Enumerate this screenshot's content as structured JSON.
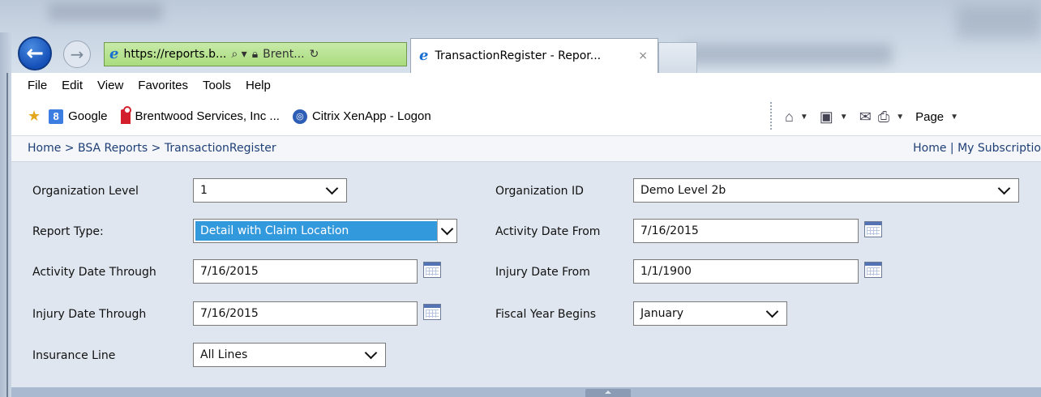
{
  "browser": {
    "address_url": "https://reports.b...",
    "address_site": "Brent...",
    "tab_title": "TransactionRegister - Repor...",
    "tab_close": "×"
  },
  "menu": [
    "File",
    "Edit",
    "View",
    "Favorites",
    "Tools",
    "Help"
  ],
  "favorites": {
    "items": [
      "Google",
      "Brentwood Services, Inc ...",
      "Citrix XenApp - Logon"
    ]
  },
  "command_bar": {
    "page_label": "Page"
  },
  "breadcrumb": {
    "path": "Home > BSA Reports > TransactionRegister",
    "links": "Home | My Subscriptio"
  },
  "params": {
    "org_level": {
      "label": "Organization Level",
      "value": "1"
    },
    "org_id": {
      "label": "Organization ID",
      "value": "Demo Level 2b"
    },
    "report_type": {
      "label": "Report Type:",
      "value": "Detail with Claim Location"
    },
    "activity_from": {
      "label": "Activity Date From",
      "value": "7/16/2015"
    },
    "activity_through": {
      "label": "Activity Date Through",
      "value": "7/16/2015"
    },
    "injury_from": {
      "label": "Injury Date From",
      "value": "1/1/1900"
    },
    "injury_through": {
      "label": "Injury Date Through",
      "value": "7/16/2015"
    },
    "fiscal_year": {
      "label": "Fiscal Year Begins",
      "value": "January"
    },
    "insurance_line": {
      "label": "Insurance Line",
      "value": "All Lines"
    }
  },
  "colors": {
    "selection_highlight": "#3399dd",
    "param_background": "#dfe6ef",
    "address_bar": "#b8e390"
  }
}
